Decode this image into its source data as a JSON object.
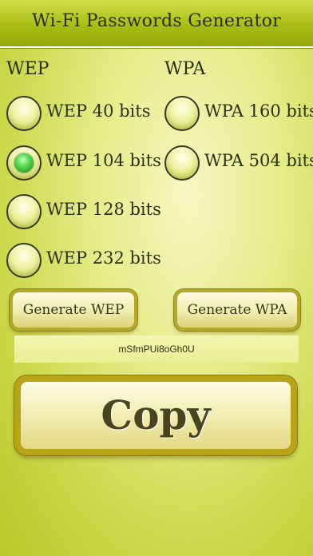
{
  "header": {
    "title": "Wi-Fi Passwords Generator"
  },
  "wep": {
    "label": "WEP",
    "options": [
      {
        "label": "WEP 40 bits",
        "selected": false
      },
      {
        "label": "WEP 104 bits",
        "selected": true
      },
      {
        "label": "WEP 128 bits",
        "selected": false
      },
      {
        "label": "WEP 232 bits",
        "selected": false
      }
    ],
    "generate_label": "Generate WEP"
  },
  "wpa": {
    "label": "WPA",
    "options": [
      {
        "label": "WPA 160 bits",
        "selected": false
      },
      {
        "label": "WPA 504 bits",
        "selected": false
      }
    ],
    "generate_label": "Generate WPA"
  },
  "password": {
    "value": "mSfmPUi8oGh0U"
  },
  "copy": {
    "label": "Copy"
  },
  "colors": {
    "title_bar": "#a9bd14",
    "background": "#e6ec8a",
    "selected_radio": "#55d84e",
    "button_border": "#b6a82a"
  }
}
